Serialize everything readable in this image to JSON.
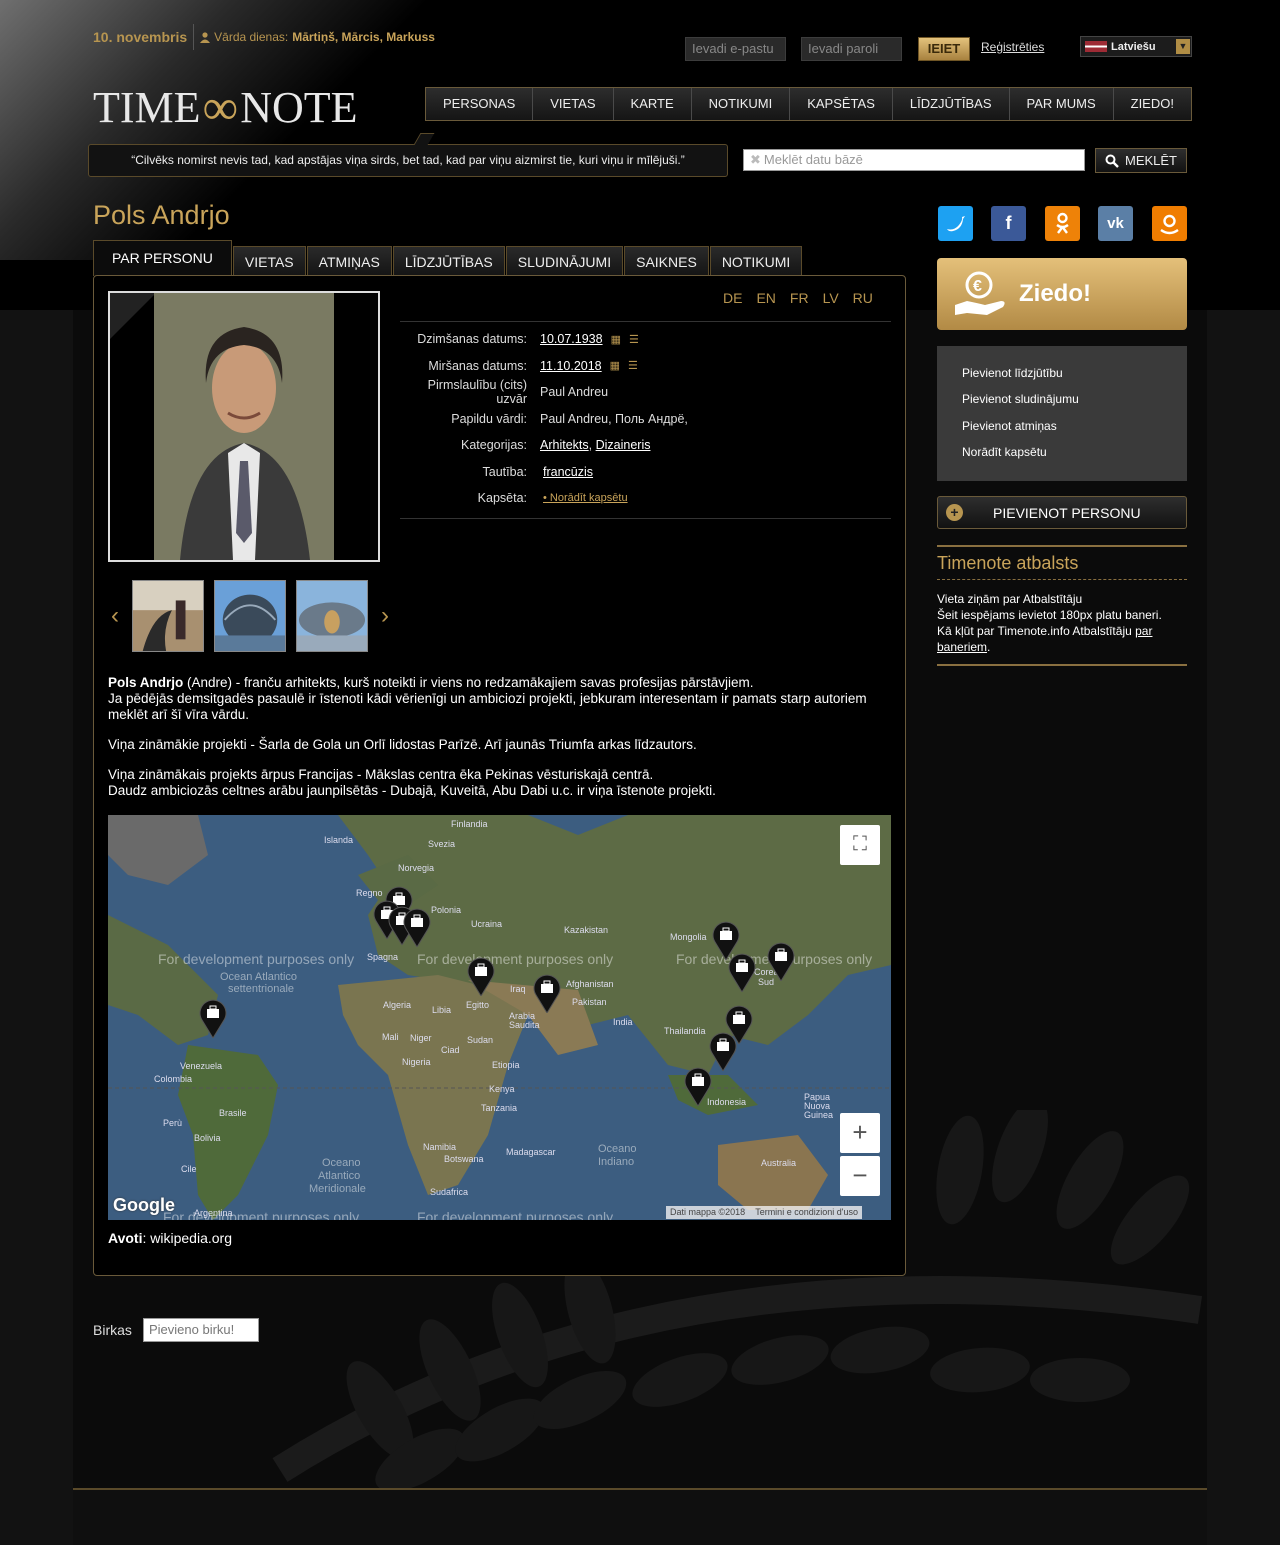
{
  "header": {
    "date": "10. novembris",
    "namedays_label": "Vārda dienas:",
    "namedays": "Mārtiņš, Mārcis, Markuss",
    "email_placeholder": "Ievadi e-pastu",
    "password_placeholder": "Ievadi paroli",
    "login_label": "IEIET",
    "register_label": "Reģistrēties",
    "language": "Latviešu"
  },
  "logo": {
    "left": "TIME",
    "right": "NOTE"
  },
  "nav": [
    "PERSONAS",
    "VIETAS",
    "KARTE",
    "NOTIKUMI",
    "KAPSĒTAS",
    "LĪDZJŪTĪBAS",
    "PAR MUMS",
    "ZIEDO!"
  ],
  "quote": "“Cilvēks nomirst nevis tad, kad apstājas viņa sirds, bet tad, kad par viņu aizmirst tie, kuri viņu ir mīlējuši.”",
  "search": {
    "placeholder": "Meklēt datu bāzē",
    "button": "MEKLĒT"
  },
  "person": {
    "name": "Pols Andrjo",
    "tabs": [
      "PAR PERSONU",
      "VIETAS",
      "ATMIŅAS",
      "LĪDZJŪTĪBAS",
      "SLUDINĀJUMI",
      "SAIKNES",
      "NOTIKUMI"
    ],
    "languages": [
      "DE",
      "EN",
      "FR",
      "LV",
      "RU"
    ],
    "info": {
      "birth_label": "Dzimšanas datums:",
      "birth": "10.07.1938",
      "death_label": "Miršanas datums:",
      "death": "11.10.2018",
      "maiden_label": "Pirmslaulību (cits) uzvār",
      "maiden": "Paul Andreu",
      "extra_label": "Papildu vārdi:",
      "extra": "Paul Andreu, Поль Андрё,",
      "cat_label": "Kategorijas:",
      "cat1": "Arhitekts",
      "cat2": "Dizaineris",
      "nat_label": "Tautība:",
      "nat": "francūzis",
      "cem_label": "Kapsēta:",
      "cem": "• Norādīt kapsētu"
    },
    "bio": {
      "name_bold": "Pols Andrjo",
      "p1": " (Andre) - franču arhitekts, kurš noteikti ir viens no redzamākajiem savas profesijas pārstāvjiem.",
      "p1b": "Ja pēdējās demsitgadēs pasaulē ir īstenoti kādi vērienīgi un ambiciozi projekti, jebkuram interesentam ir pamats starp autoriem meklēt arī šī vīra vārdu.",
      "p2": "Viņa zināmākie projekti - Šarla de Gola un Orlī lidostas Parīzē. Arī jaunās Triumfa arkas līdzautors.",
      "p3": "Viņa zināmākais projekts ārpus Francijas - Mākslas centra ēka Pekinas vēsturiskajā centrā.",
      "p3b": "Daudz ambiciozās celtnes arābu jaunpilsētās - Dubajā, Kuveitā, Abu Dabi u.c. ir viņa īstenote projekti."
    },
    "sources_label": "Avoti",
    "sources": "wikipedia.org"
  },
  "map": {
    "dev_text": "For development purposes only",
    "attribution": "Dati mappa ©2018",
    "terms": "Termini e condizioni d'uso",
    "google": "Google",
    "labels": [
      "Finlandia",
      "Islanda",
      "Svezia",
      "Norvegia",
      "Regno",
      "Polonia",
      "Ucraina",
      "Kazakistan",
      "Mongolia",
      "Spagna",
      "Ocean Atlantico",
      "settentrionale",
      "Algeria",
      "Libia",
      "Egitto",
      "Iraq",
      "Afghanistan",
      "Pakistan",
      "India",
      "Corea",
      "Sud",
      "Mali",
      "Niger",
      "Ciad",
      "Sudan",
      "Arabia",
      "Saudita",
      "Etiopia",
      "Thailandia",
      "Venezuela",
      "Colombia",
      "Nigeria",
      "Kenya",
      "Tanzania",
      "Indonesia",
      "Brasile",
      "Perù",
      "Bolivia",
      "Cile",
      "Argentina",
      "Namibia",
      "Botswana",
      "Madagascar",
      "Sudafrica",
      "Oceano",
      "Indiano",
      "Atlantico",
      "Meridionale",
      "Papua",
      "Nuova",
      "Guinea",
      "Australia"
    ]
  },
  "tags": {
    "label": "Birkas",
    "placeholder": "Pievieno birku!"
  },
  "sidebar": {
    "donate": "Ziedo!",
    "actions": [
      "Pievienot līdzjūtību",
      "Pievienot sludinājumu",
      "Pievienot atmiņas",
      "Norādīt kapsētu"
    ],
    "add_person": "PIEVIENOT PERSONU",
    "support_title": "Timenote atbalsts",
    "support_l1": "Vieta ziņām par Atbalstītāju",
    "support_l2": "Šeit iespējams ievietot 180px platu baneri.",
    "support_l3": "Kā kļūt par Timenote.info Atbalstītāju ",
    "support_link1": "par",
    "support_link2": "baneriem",
    "support_end": "."
  },
  "colors": {
    "accent": "#c9a45a",
    "background": "#000000",
    "panel_border": "#6a5a3a"
  }
}
